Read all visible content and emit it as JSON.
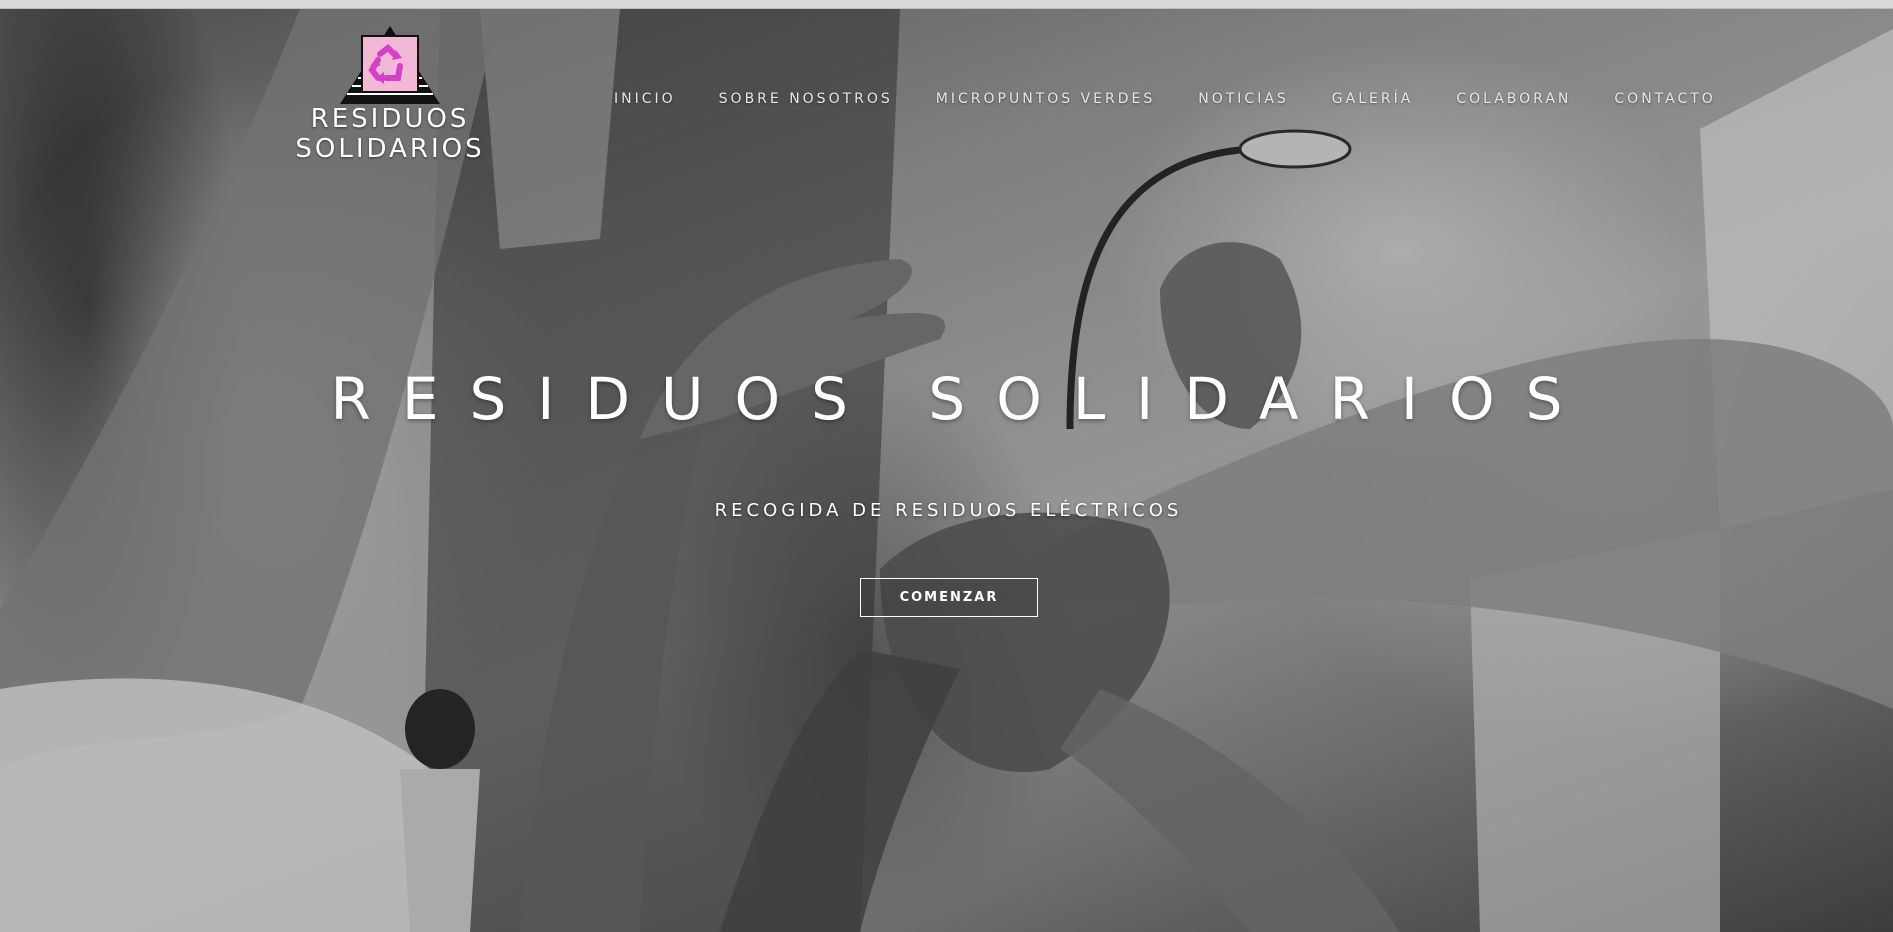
{
  "brand": {
    "logo_icon": "recycle-icon",
    "name_line1": "RESIDUOS",
    "name_line2": "SOLIDARIOS",
    "accent_color": "#d63fc8",
    "mark_background": "#f2b9d6"
  },
  "nav": {
    "items": [
      {
        "label": "INICIO"
      },
      {
        "label": "SOBRE NOSOTROS"
      },
      {
        "label": "MICROPUNTOS VERDES"
      },
      {
        "label": "NOTICIAS"
      },
      {
        "label": "GALERÍA"
      },
      {
        "label": "COLABORAN"
      },
      {
        "label": "CONTACTO"
      }
    ]
  },
  "hero": {
    "title": "RESIDUOS SOLIDARIOS",
    "subtitle": "RECOGIDA DE RESIDUOS ELÉCTRICOS",
    "cta_label": "COMENZAR",
    "background_image": "grayscale-photo-raised-hands"
  }
}
